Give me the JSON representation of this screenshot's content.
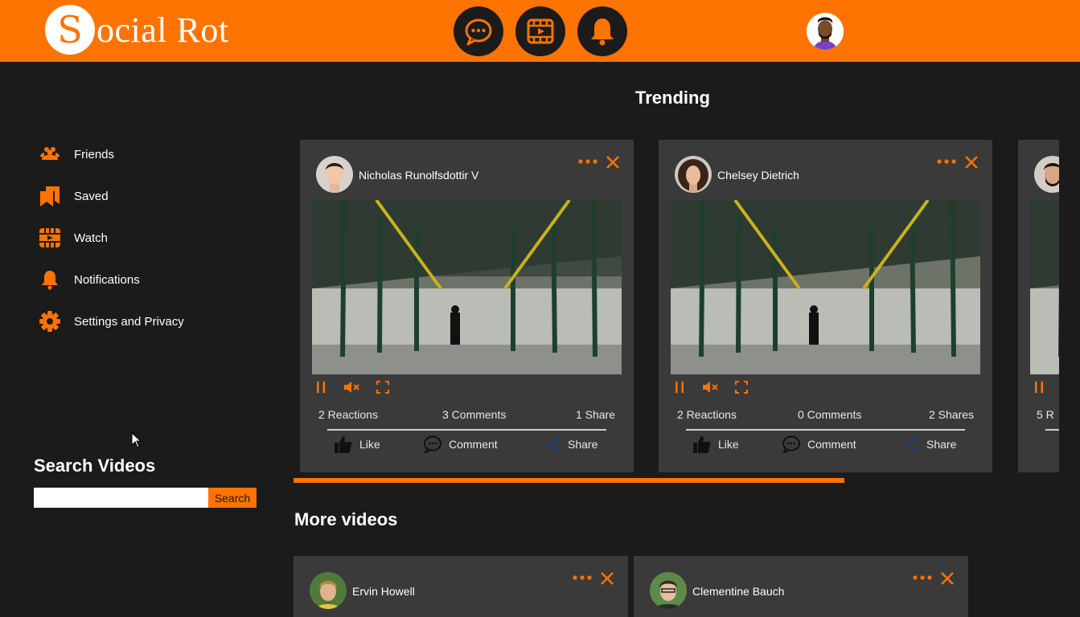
{
  "header": {
    "logo_letter": "S",
    "logo_text": "ocial Rot",
    "brand_color": "#ff7300",
    "icons": [
      "chat-icon",
      "video-icon",
      "bell-icon"
    ]
  },
  "sidebar": {
    "items": [
      {
        "label": "Friends",
        "icon": "friends-icon"
      },
      {
        "label": "Saved",
        "icon": "saved-icon"
      },
      {
        "label": "Watch",
        "icon": "watch-icon"
      },
      {
        "label": "Notifications",
        "icon": "bell-icon"
      },
      {
        "label": "Settings and Privacy",
        "icon": "gear-icon"
      }
    ]
  },
  "search": {
    "title": "Search Videos",
    "placeholder": "",
    "value": "",
    "button_label": "Search"
  },
  "trending": {
    "title": "Trending",
    "cards": [
      {
        "author": "Nicholas Runolfsdottir V",
        "reactions": "2 Reactions",
        "comments": "3 Comments",
        "shares": "1 Share",
        "like_label": "Like",
        "comment_label": "Comment",
        "share_label": "Share"
      },
      {
        "author": "Chelsey Dietrich",
        "reactions": "2 Reactions",
        "comments": "0 Comments",
        "shares": "2 Shares",
        "like_label": "Like",
        "comment_label": "Comment",
        "share_label": "Share"
      },
      {
        "author": "",
        "reactions": "5 R",
        "comments": "",
        "shares": "",
        "like_label": "",
        "comment_label": "",
        "share_label": ""
      }
    ]
  },
  "more_videos": {
    "title": "More videos",
    "cards": [
      {
        "author": "Ervin Howell"
      },
      {
        "author": "Clementine Bauch"
      }
    ]
  }
}
